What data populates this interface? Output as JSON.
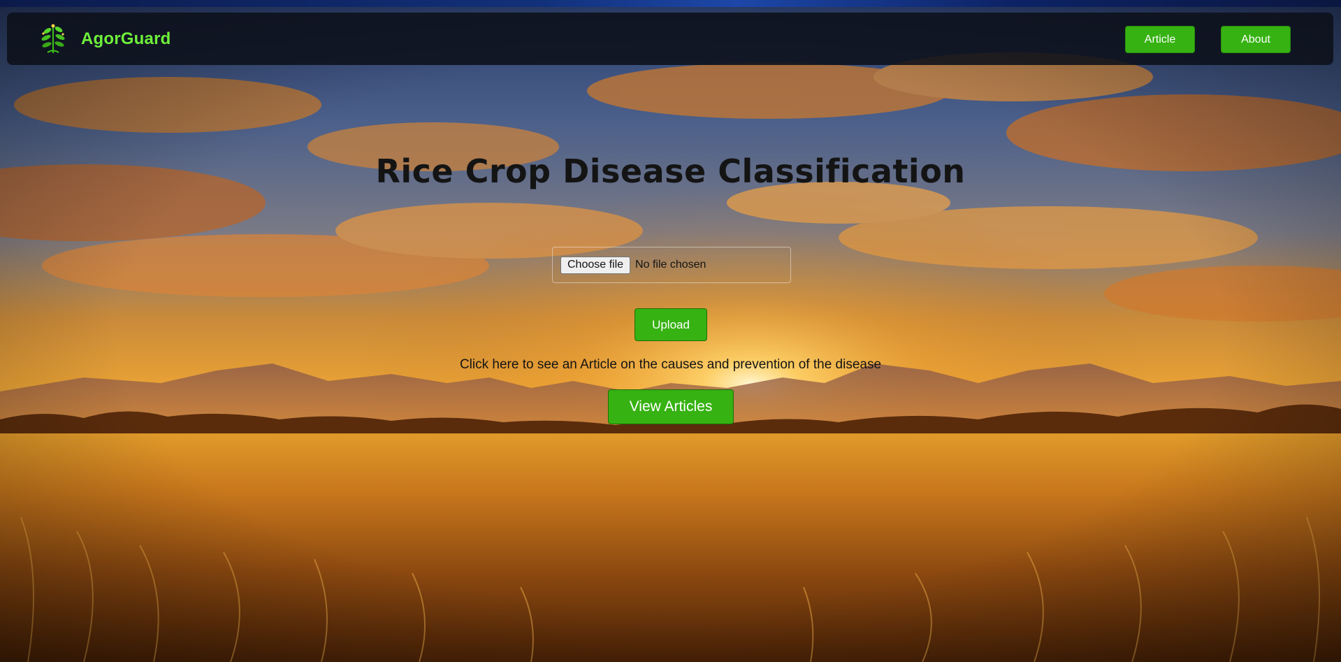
{
  "navbar": {
    "brand_name": "AgorGuard",
    "logo_icon": "plant-sprout-icon",
    "links": [
      {
        "label": "Article"
      },
      {
        "label": "About"
      }
    ]
  },
  "main": {
    "title": "Rice Crop Disease Classification",
    "file_input": {
      "button_label": "Choose file",
      "status": "No file chosen"
    },
    "upload_label": "Upload",
    "article_hint": "Click here to see an Article on the causes and prevention of the disease",
    "view_articles_label": "View Articles"
  },
  "colors": {
    "accent_green": "#36b212",
    "brand_green": "#6ef03a",
    "navbar_bg": "#0c101a"
  }
}
